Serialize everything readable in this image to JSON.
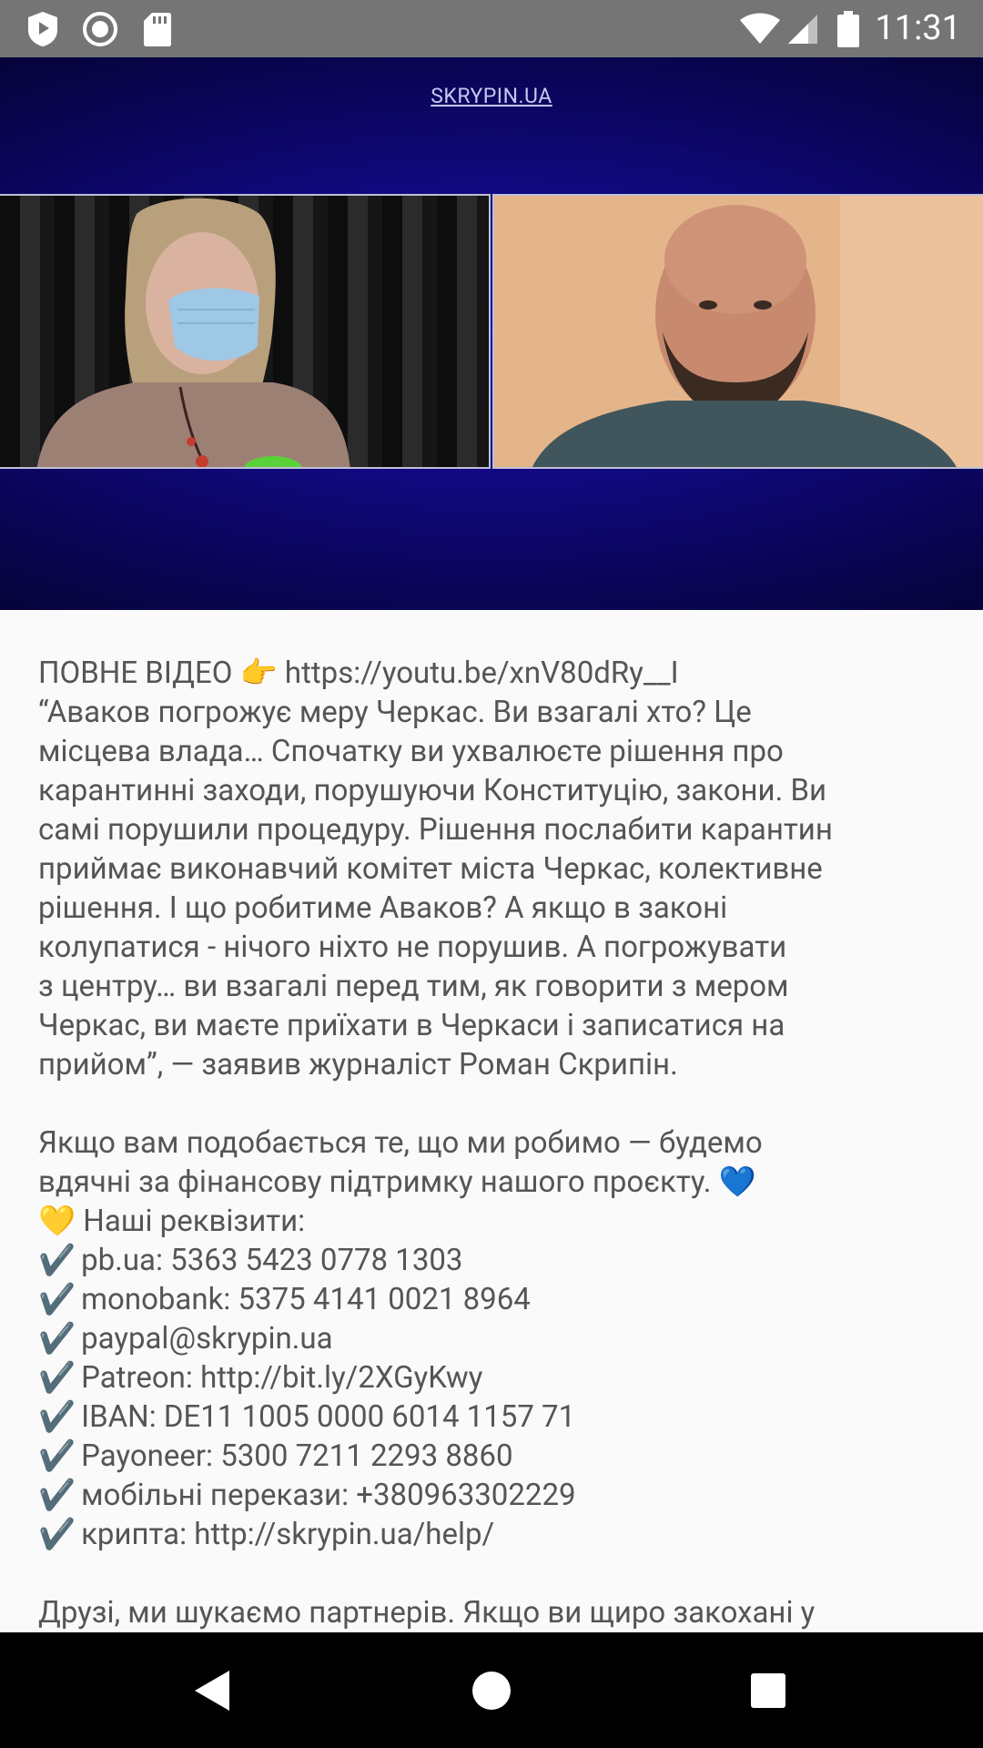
{
  "status_bar": {
    "time": "11:31",
    "icons": [
      "play-protect-icon",
      "circle-icon",
      "sd-card-icon",
      "wifi-icon",
      "cell-signal-icon",
      "battery-icon"
    ]
  },
  "video": {
    "site_label": "SKRYPIN.UA"
  },
  "post": {
    "lines": [
      "ПОВНЕ ВІДЕО 👉 https://youtu.be/xnV80dRy__I",
      "“Аваков погрожує меру Черкас. Ви взагалі хто? Це",
      "місцева влада…  Спочатку ви ухвалюєте рішення про",
      "карантинні заходи, порушуючи Конституцію, закони. Ви",
      "самі порушили процедуру. Рішення послабити карантин",
      "приймає виконавчий комітет міста Черкас, колективне",
      "рішення. І що робитиме Аваков? А якщо в законі",
      "колупатися - нічого ніхто не порушив. А погрожувати",
      "з центру… ви взагалі перед тим, як говорити з мером",
      "Черкас, ви маєте приїхати в Черкаси і записатися на",
      "прийом”, — заявив журналіст Роман Скрипін.",
      "",
      "Якщо вам подобається те, що ми робимо — будемо",
      "вдячні за фінансову підтримку нашого проєкту. 💙",
      "💛  Наші реквізити:"
    ],
    "checklist": [
      "pb.ua: 5363 5423 0778 1303",
      "monobank: 5375 4141 0021 8964",
      "paypal@skrypin.ua",
      "Patreon: http://bit.ly/2XGyKwy",
      "IBAN: DE11 1005 0000 6014 1157 71",
      "Payoneer: 5300 7211 2293 8860",
      "мобільні перекази: +380963302229",
      "крипта: http://skrypin.ua/help/"
    ],
    "check_glyph": "✔️",
    "tail_lines": [
      "",
      "Друзі, ми шукаємо партнерів. Якщо ви щиро закохані у"
    ]
  },
  "nav_bar": {
    "buttons": [
      "back-icon",
      "home-icon",
      "recents-icon"
    ]
  },
  "colors": {
    "status_bar": "#757575",
    "text": "#555555",
    "background": "#fafafa",
    "video_blue": "#1a0cb8"
  }
}
